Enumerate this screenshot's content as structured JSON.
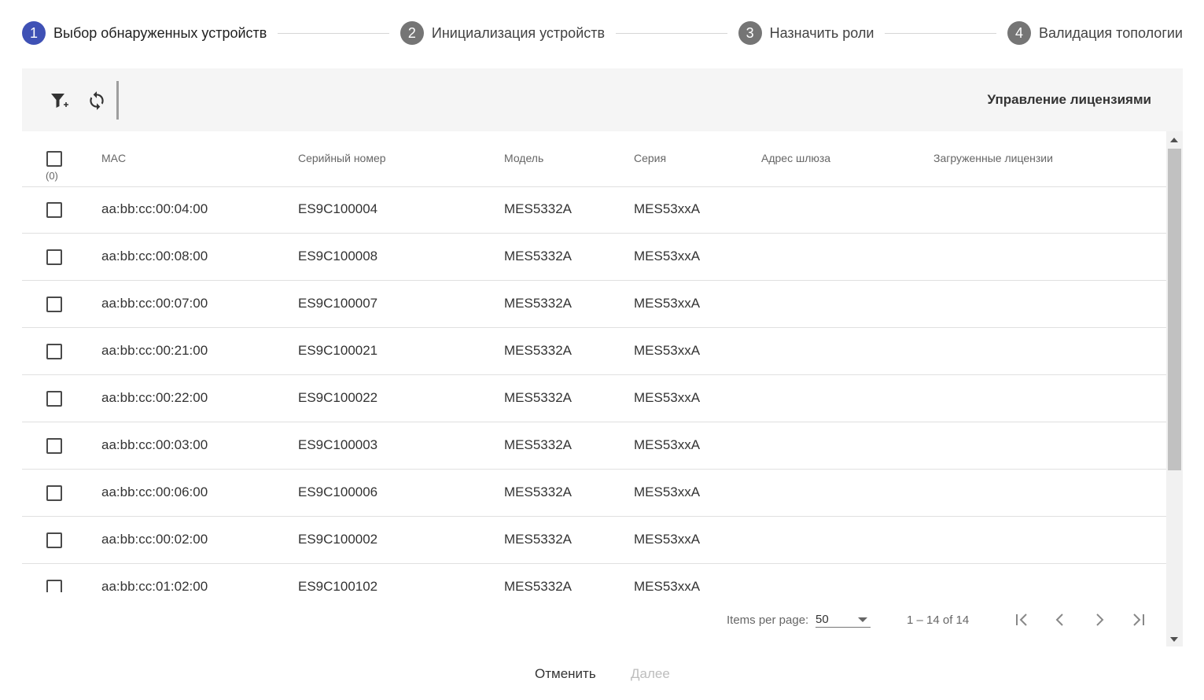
{
  "stepper": {
    "steps": [
      {
        "number": "1",
        "label": "Выбор обнаруженных устройств"
      },
      {
        "number": "2",
        "label": "Инициализация устройств"
      },
      {
        "number": "3",
        "label": "Назначить роли"
      },
      {
        "number": "4",
        "label": "Валидация топологии"
      }
    ],
    "active_step": "1"
  },
  "toolbar": {
    "filter_icon": "filter-add-icon",
    "refresh_icon": "refresh-icon",
    "license_label": "Управление лицензиями"
  },
  "table": {
    "selected_count": "(0)",
    "headers": {
      "mac": "MAC",
      "serial": "Серийный номер",
      "model": "Модель",
      "series": "Серия",
      "gateway": "Адрес шлюза",
      "licenses": "Загруженные лицензии"
    },
    "rows": [
      {
        "mac": "aa:bb:cc:00:04:00",
        "serial": "ES9C100004",
        "model": "MES5332A",
        "series": "MES53xxA"
      },
      {
        "mac": "aa:bb:cc:00:08:00",
        "serial": "ES9C100008",
        "model": "MES5332A",
        "series": "MES53xxA"
      },
      {
        "mac": "aa:bb:cc:00:07:00",
        "serial": "ES9C100007",
        "model": "MES5332A",
        "series": "MES53xxA"
      },
      {
        "mac": "aa:bb:cc:00:21:00",
        "serial": "ES9C100021",
        "model": "MES5332A",
        "series": "MES53xxA"
      },
      {
        "mac": "aa:bb:cc:00:22:00",
        "serial": "ES9C100022",
        "model": "MES5332A",
        "series": "MES53xxA"
      },
      {
        "mac": "aa:bb:cc:00:03:00",
        "serial": "ES9C100003",
        "model": "MES5332A",
        "series": "MES53xxA"
      },
      {
        "mac": "aa:bb:cc:00:06:00",
        "serial": "ES9C100006",
        "model": "MES5332A",
        "series": "MES53xxA"
      },
      {
        "mac": "aa:bb:cc:00:02:00",
        "serial": "ES9C100002",
        "model": "MES5332A",
        "series": "MES53xxA"
      },
      {
        "mac": "aa:bb:cc:01:02:00",
        "serial": "ES9C100102",
        "model": "MES5332A",
        "series": "MES53xxA"
      }
    ]
  },
  "paginator": {
    "items_per_page_label": "Items per page:",
    "items_per_page_value": "50",
    "range_label": "1 – 14 of 14"
  },
  "footer": {
    "cancel_label": "Отменить",
    "next_label": "Далее"
  },
  "colors": {
    "accent": "#3f51b5",
    "step_inactive": "#757575",
    "toolbar_bg": "#f5f5f5",
    "disabled_text": "#bdbdbd"
  }
}
